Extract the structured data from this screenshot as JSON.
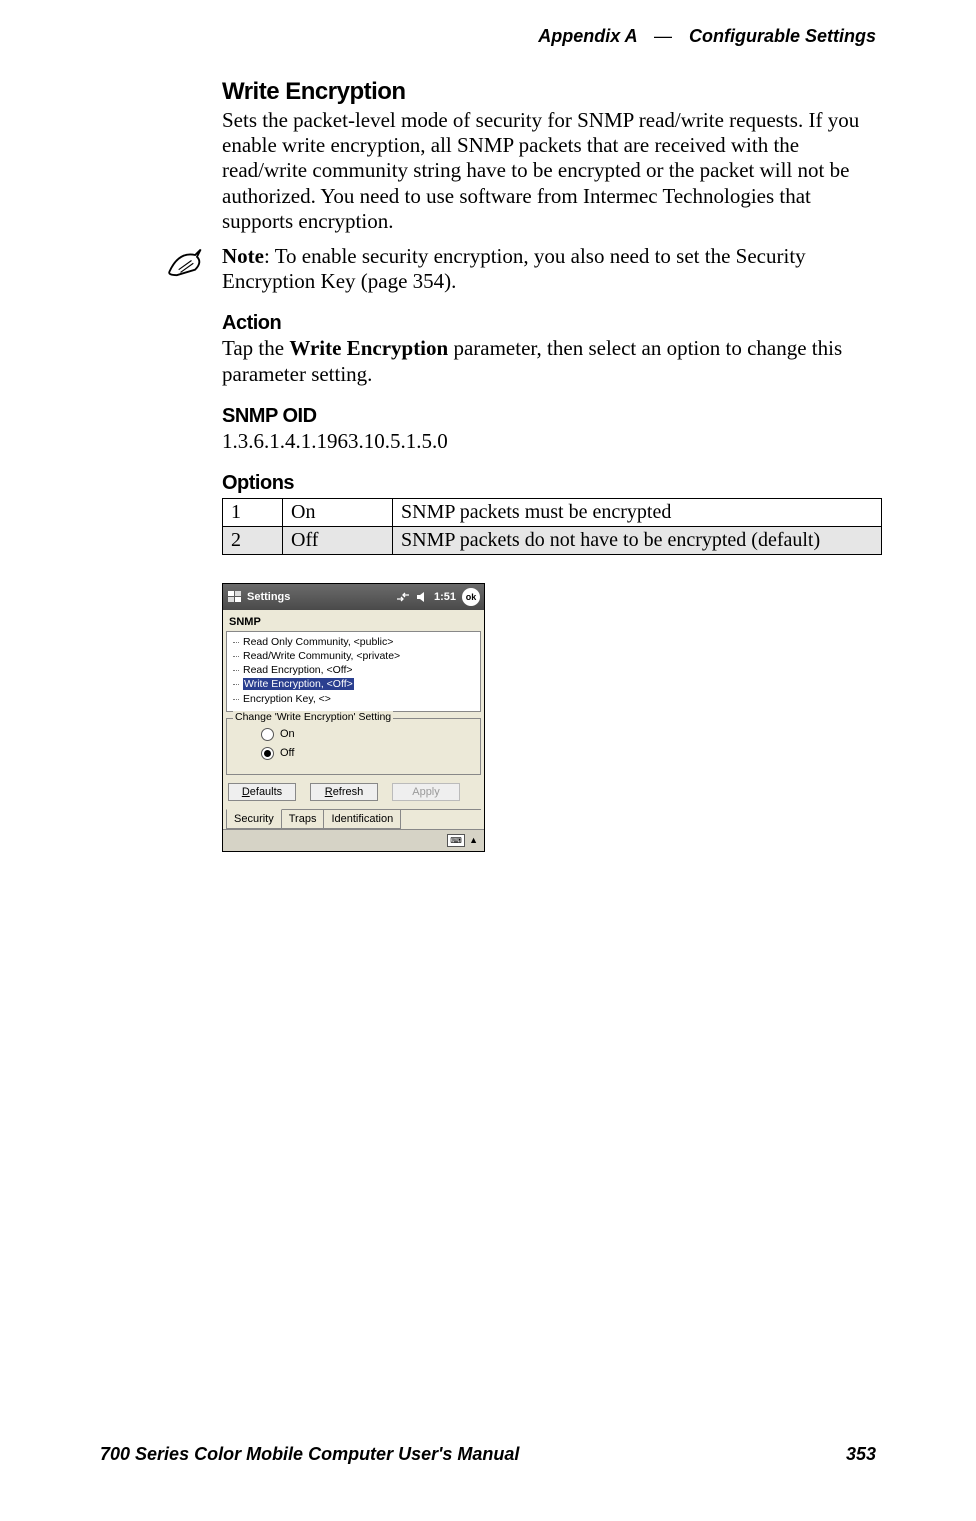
{
  "header": {
    "appendix": "Appendix A",
    "separator": "—",
    "title": "Configurable Settings"
  },
  "content": {
    "section_title": "Write Encryption",
    "intro": "Sets the packet-level mode of security for SNMP read/write requests. If you enable write encryption, all SNMP packets that are received with the read/write community string have to be encrypted or the packet will not be authorized. You need to use software from Intermec Technologies that supports encryption.",
    "note_label": "Note",
    "note_text": ": To enable security encryption, you also need to set the Security Encryption Key (page 354).",
    "action_title": "Action",
    "action_prefix": "Tap the ",
    "action_bold": "Write Encryption",
    "action_suffix": " parameter, then select an option to change this parameter setting.",
    "snmp_oid_title": "SNMP OID",
    "snmp_oid_value": "1.3.6.1.4.1.1963.10.5.1.5.0",
    "options_title": "Options",
    "options": [
      {
        "num": "1",
        "name": "On",
        "desc": "SNMP packets must be encrypted"
      },
      {
        "num": "2",
        "name": "Off",
        "desc": "SNMP packets do not have to be encrypted (default)"
      }
    ]
  },
  "screenshot": {
    "taskbar": {
      "title": "Settings",
      "time": "1:51",
      "ok": "ok"
    },
    "panel_label": "SNMP",
    "tree": [
      "Read Only Community, <public>",
      "Read/Write Community, <private>",
      "Read Encryption, <Off>",
      "Write Encryption, <Off>",
      "Encryption Key, <>"
    ],
    "tree_selected_index": 3,
    "fieldset_legend": "Change 'Write Encryption' Setting",
    "radios": {
      "on": "On",
      "off": "Off",
      "selected": "off"
    },
    "buttons": {
      "defaults": "Defaults",
      "refresh": "Refresh",
      "apply": "Apply"
    },
    "tabs": [
      "Security",
      "Traps",
      "Identification"
    ],
    "active_tab_index": 0
  },
  "footer": {
    "book_title": "700 Series Color Mobile Computer User's Manual",
    "page_number": "353"
  }
}
